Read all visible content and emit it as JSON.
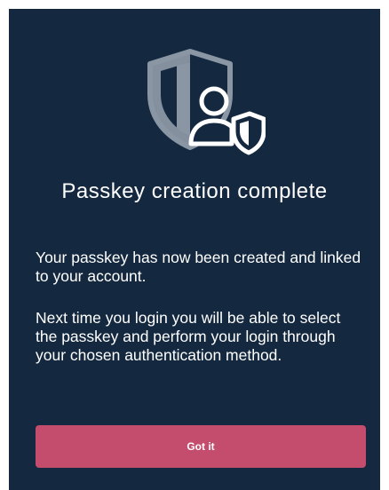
{
  "dialog": {
    "icon": "passkey-shield-user-icon",
    "title": "Passkey creation complete",
    "paragraphs": [
      "Your passkey has now been created and linked to your account.",
      "Next time you login you will be able to select the passkey and perform your login through your chosen authentication method."
    ],
    "button_label": "Got it"
  },
  "colors": {
    "background": "#14283f",
    "button": "#c44d6e",
    "shield": "#8a96a3",
    "text": "#ffffff"
  }
}
